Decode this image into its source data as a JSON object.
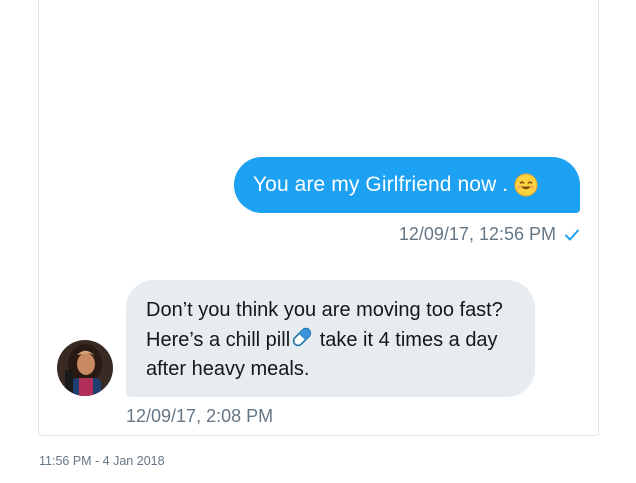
{
  "conversation": {
    "outgoing": {
      "text": "You are my Girlfriend now .",
      "emoji": "smiling-face-emoji",
      "timestamp": "12/09/17, 12:56 PM",
      "status_icon": "checkmark-icon"
    },
    "incoming": {
      "text_before_pill": "Don’t you think you are moving too fast? Here’s a chill pill",
      "pill_icon": "pill-emoji",
      "text_after_pill": " take it 4 times a day after heavy meals.",
      "timestamp": "12/09/17, 2:08 PM"
    }
  },
  "footer": {
    "tweet_time": "11:56 PM - 4 Jan 2018"
  },
  "colors": {
    "outgoing_bubble": "#1da1f2",
    "incoming_bubble": "#e6ecf0",
    "meta_text": "#657786"
  }
}
